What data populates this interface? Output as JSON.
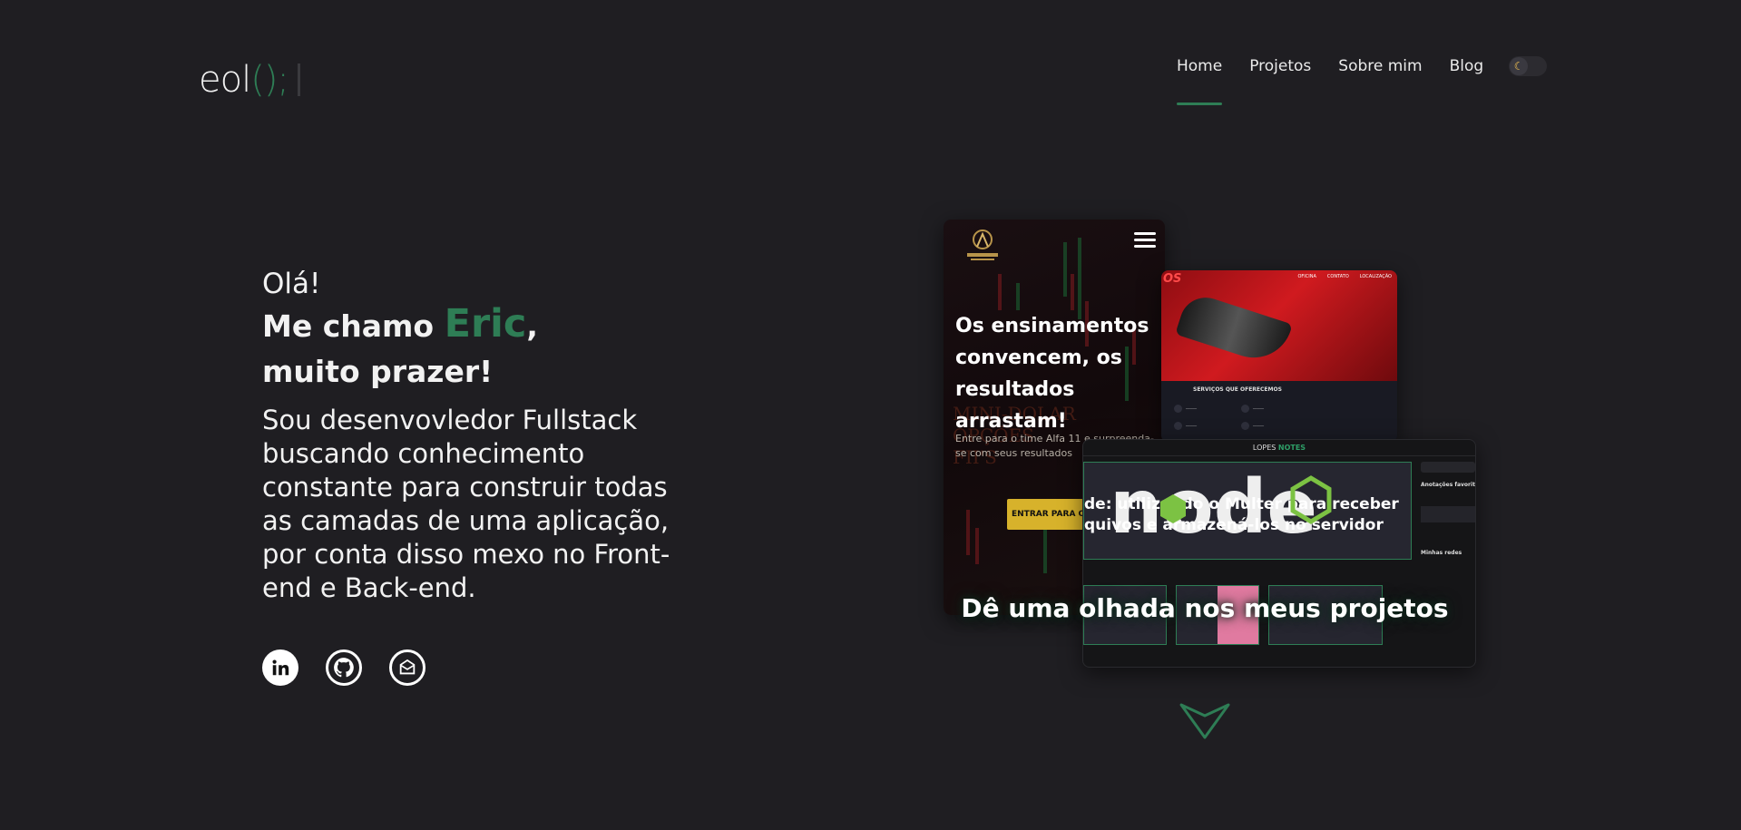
{
  "header": {
    "logo": {
      "text": "eol",
      "open_paren": "(",
      "close": ");"
    },
    "nav": [
      {
        "label": "Home",
        "active": true
      },
      {
        "label": "Projetos",
        "active": false
      },
      {
        "label": "Sobre mim",
        "active": false
      },
      {
        "label": "Blog",
        "active": false
      }
    ],
    "theme_toggle": {
      "icon": "moon-icon",
      "state": "dark"
    }
  },
  "hero": {
    "greeting": "Olá!",
    "intro_prefix": "Me chamo",
    "name": "Eric",
    "intro_suffix": ",",
    "line2": "muito prazer!",
    "bio": "Sou desenvovledor Fullstack buscando conhecimento constante para construir todas as camadas de uma aplicação, por conta disso mexo no Front-end e Back-end."
  },
  "social": [
    {
      "name": "linkedin-icon"
    },
    {
      "name": "github-icon"
    },
    {
      "name": "email-icon"
    }
  ],
  "showcase": {
    "alfa": {
      "headline": "Os ensinamentos convencem, os resultados arrastam!",
      "sub": "Entre para o time Alfa 11 e surpreenda-se com seus resultados",
      "cta": "ENTRAR PARA O T",
      "ghost": "MINI-DOLAR\nOPÇÕES\nFII'S"
    },
    "cars": {
      "services_title": "SERVIÇOS QUE OFERECEMOS",
      "nav_items": [
        "OFICINA",
        "CONTATO",
        "LOCALIZAÇÃO"
      ]
    },
    "lopes": {
      "brand_a": "LOPES",
      "brand_b": "NOTES",
      "post_title": "de: utilizando o Multer para receber quivos e armazená-los no servidor",
      "side_title": "Anotações favorit",
      "side_links": "Minhas redes"
    },
    "cta": "Dê uma olhada nos meus projetos"
  },
  "colors": {
    "accent": "#2e7d55",
    "background": "#1f1e22"
  }
}
